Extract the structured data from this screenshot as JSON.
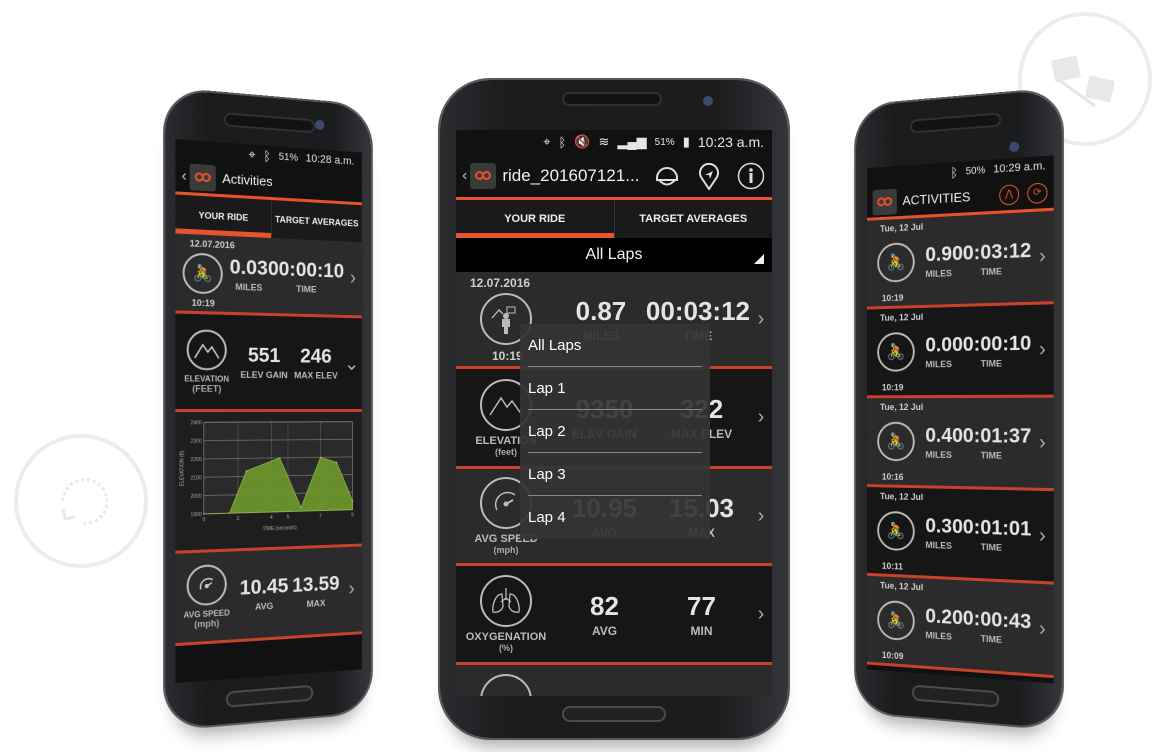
{
  "decorations": {
    "top_right_icon": "checkered-flags-icon",
    "left_icon": "refresh-loop-icon"
  },
  "center_phone": {
    "status_bar": {
      "battery_pct": "51%",
      "time": "10:23 a.m.",
      "icons": [
        "location-icon",
        "bluetooth-icon",
        "mute-icon",
        "wifi-icon",
        "signal-icon",
        "battery-icon"
      ]
    },
    "app_bar": {
      "back": "‹",
      "title": "ride_201607121...",
      "actions": [
        "helmet-icon",
        "map-pin-icon",
        "info-icon"
      ]
    },
    "tabs": [
      {
        "label": "YOUR RIDE",
        "active": true
      },
      {
        "label": "TARGET AVERAGES",
        "active": false
      }
    ],
    "lap_selector": {
      "selected": "All Laps"
    },
    "dropdown_menu": {
      "items": [
        "All Laps",
        "Lap 1",
        "Lap 2",
        "Lap 3",
        "Lap 4"
      ]
    },
    "rows": [
      {
        "kind": "ride",
        "date": "12.07.2016",
        "time_of_day": "10:19",
        "v1": "0.87",
        "l1": "MILES",
        "v2": "00:03:12",
        "l2": "TIME"
      },
      {
        "kind": "elevation",
        "label": "ELEVATION",
        "unit": "(feet)",
        "v1": "9350",
        "l1": "ELEV GAIN",
        "v2": "322",
        "l2": "MAX ELEV"
      },
      {
        "kind": "speed",
        "label": "AVG SPEED",
        "unit": "(mph)",
        "v1": "10.95",
        "l1": "AVG",
        "v2": "15.03",
        "l2": "MAX"
      },
      {
        "kind": "oxygen",
        "label": "OXYGENATION",
        "unit": "(%)",
        "v1": "82",
        "l1": "AVG",
        "v2": "77",
        "l2": "MIN"
      }
    ],
    "chevron": "›"
  },
  "left_phone": {
    "status_bar": {
      "battery_pct": "51%",
      "time": "10:28 a.m."
    },
    "app_bar": {
      "back": "‹",
      "title": "Activities"
    },
    "tabs": [
      {
        "label": "YOUR RIDE",
        "active": true
      },
      {
        "label": "TARGET AVERAGES",
        "active": false
      }
    ],
    "ride": {
      "date": "12.07.2016",
      "time_of_day": "10:19",
      "v1": "0.03",
      "l1": "MILES",
      "v2": "00:00:10",
      "l2": "TIME"
    },
    "elevation": {
      "label": "ELEVATION",
      "unit": "(FEET)",
      "v1": "551",
      "l1": "ELEV GAIN",
      "v2": "246",
      "l2": "MAX ELEV",
      "chevron": "⌄"
    },
    "speed": {
      "label": "AVG SPEED",
      "unit": "(mph)",
      "v1": "10.45",
      "l1": "AVG",
      "v2": "13.59",
      "l2": "MAX"
    },
    "chevron": "›"
  },
  "right_phone": {
    "status_bar": {
      "battery_pct": "50%",
      "time": "10:29 a.m."
    },
    "app_bar": {
      "title": "ACTIVITIES"
    },
    "activities": [
      {
        "date": "Tue, 12 Jul",
        "time_of_day": "10:19",
        "miles": "0.9",
        "miles_label": "MILES",
        "duration": "00:03:12",
        "duration_label": "TIME"
      },
      {
        "date": "Tue, 12 Jul",
        "time_of_day": "10:19",
        "miles": "0.0",
        "miles_label": "MILES",
        "duration": "00:00:10",
        "duration_label": "TIME"
      },
      {
        "date": "Tue, 12 Jul",
        "time_of_day": "10:16",
        "miles": "0.4",
        "miles_label": "MILES",
        "duration": "00:01:37",
        "duration_label": "TIME"
      },
      {
        "date": "Tue, 12 Jul",
        "time_of_day": "10:11",
        "miles": "0.3",
        "miles_label": "MILES",
        "duration": "00:01:01",
        "duration_label": "TIME"
      },
      {
        "date": "Tue, 12 Jul",
        "time_of_day": "10:09",
        "miles": "0.2",
        "miles_label": "MILES",
        "duration": "00:00:43",
        "duration_label": "TIME"
      }
    ],
    "chevron": "›"
  },
  "chart_data": {
    "type": "area",
    "title": "",
    "xlabel": "TIME (seconds)",
    "ylabel": "ELEVATION (ft)",
    "x_ticks": [
      "0",
      "2",
      "4",
      "5",
      "7",
      "9"
    ],
    "y_ticks": [
      "1900",
      "2000",
      "2100",
      "2200",
      "2300",
      "2400"
    ],
    "x": [
      0,
      1.5,
      2.5,
      4.5,
      5.8,
      7,
      8,
      9
    ],
    "y": [
      1900,
      1900,
      2130,
      2200,
      1920,
      2200,
      2170,
      1950
    ],
    "xlim": [
      0,
      9
    ],
    "ylim": [
      1900,
      2400
    ],
    "color": "#6d9a2c",
    "grid": true
  }
}
